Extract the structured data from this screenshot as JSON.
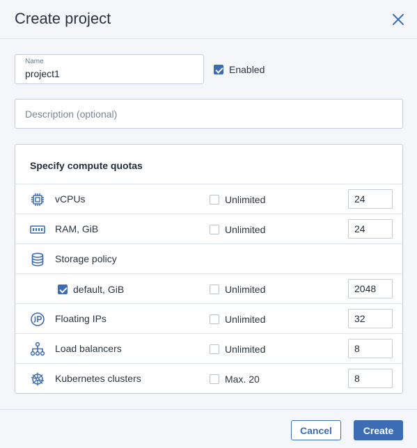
{
  "dialog": {
    "title": "Create project",
    "close_icon": "close-icon"
  },
  "form": {
    "name_label": "Name",
    "name_value": "project1",
    "enabled_label": "Enabled",
    "enabled_checked": true,
    "description_placeholder": "Description (optional)",
    "description_value": ""
  },
  "quotas": {
    "title": "Specify compute quotas",
    "rows": [
      {
        "icon": "cpu-icon",
        "label": "vCPUs",
        "unlimited_label": "Unlimited",
        "unlimited_checked": false,
        "value": "24"
      },
      {
        "icon": "memory-icon",
        "label": "RAM, GiB",
        "unlimited_label": "Unlimited",
        "unlimited_checked": false,
        "value": "24"
      },
      {
        "icon": "database-icon",
        "label": "Storage policy"
      },
      {
        "label": "default, GiB",
        "checked": true,
        "unlimited_label": "Unlimited",
        "unlimited_checked": false,
        "value": "2048"
      },
      {
        "icon": "floating-ip-icon",
        "label": "Floating IPs",
        "unlimited_label": "Unlimited",
        "unlimited_checked": false,
        "value": "32"
      },
      {
        "icon": "load-balancer-icon",
        "label": "Load balancers",
        "unlimited_label": "Unlimited",
        "unlimited_checked": false,
        "value": "8"
      },
      {
        "icon": "kubernetes-icon",
        "label": "Kubernetes clusters",
        "unlimited_label": "Max. 20",
        "unlimited_checked": false,
        "value": "8"
      }
    ]
  },
  "footer": {
    "cancel_label": "Cancel",
    "create_label": "Create"
  },
  "colors": {
    "accent": "#3b6cb4",
    "background": "#f4f6fa",
    "border": "#c6cdd8"
  }
}
